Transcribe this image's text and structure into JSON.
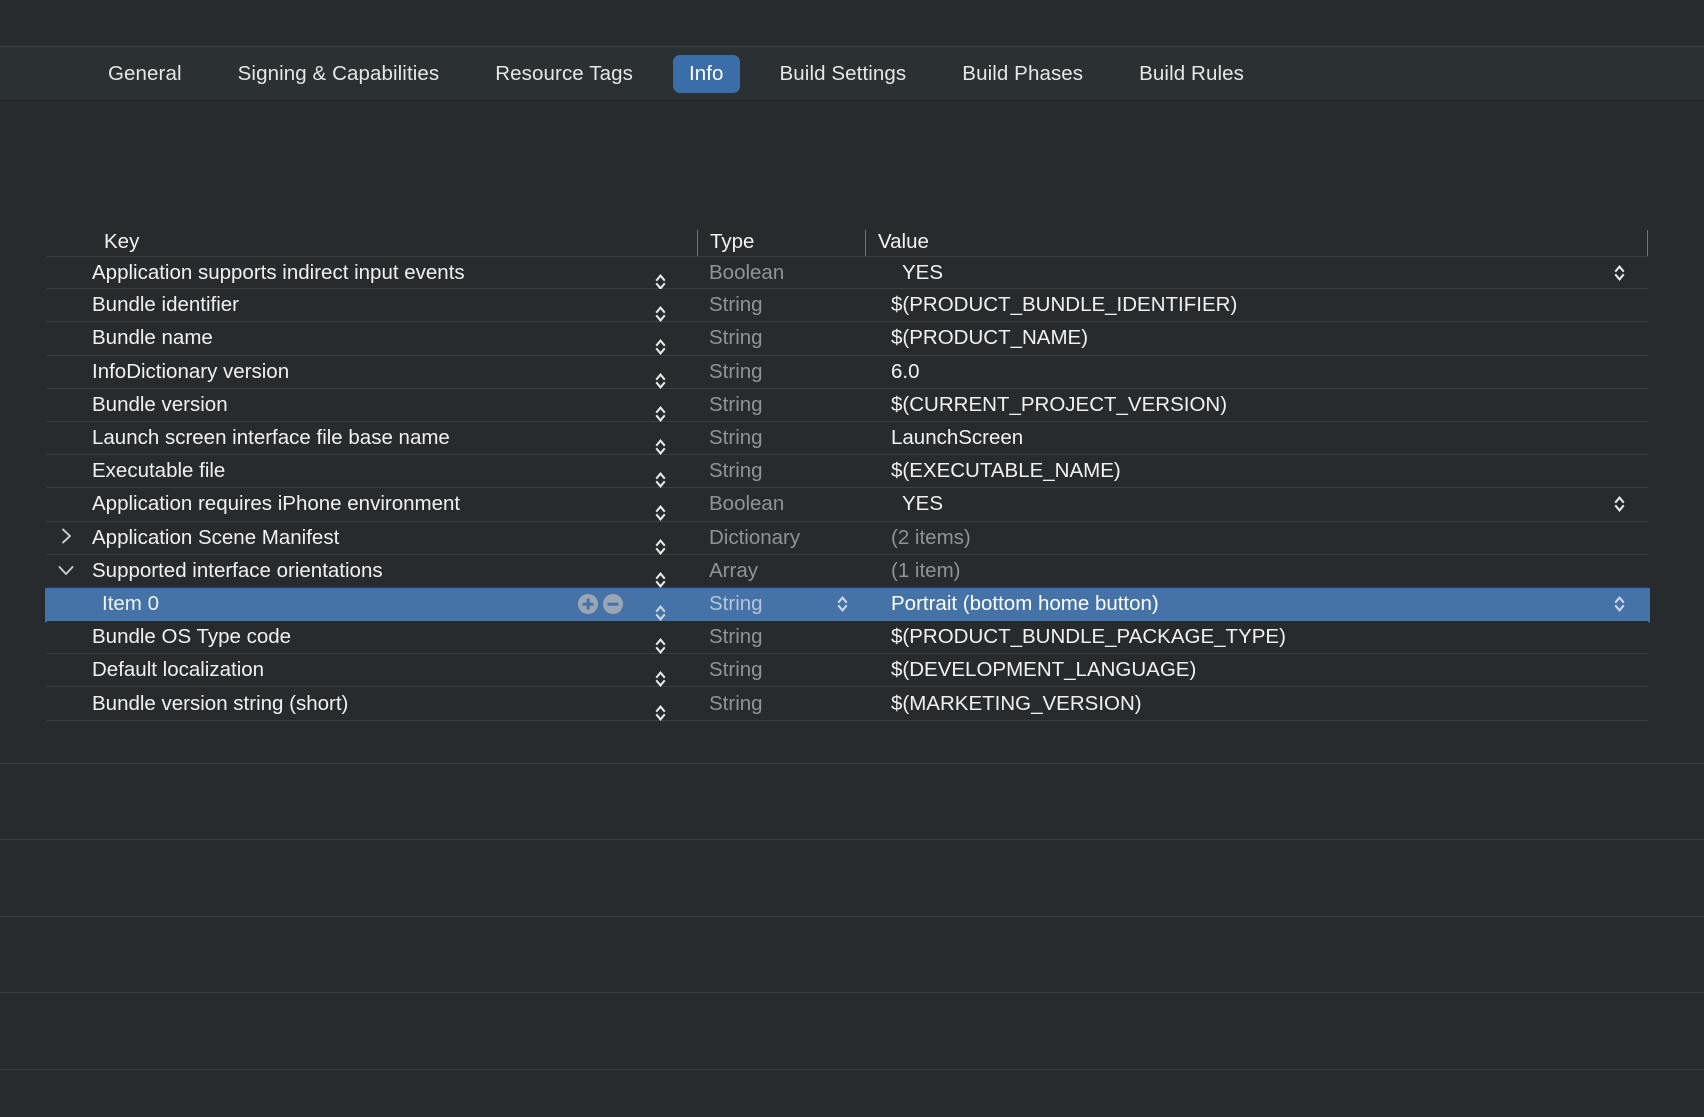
{
  "window": {
    "background": "#272b2d",
    "accent": "#3b6ea8",
    "selection": "#4573a8"
  },
  "tabs": [
    {
      "label": "General",
      "active": false
    },
    {
      "label": "Signing & Capabilities",
      "active": false
    },
    {
      "label": "Resource Tags",
      "active": false
    },
    {
      "label": "Info",
      "active": true
    },
    {
      "label": "Build Settings",
      "active": false
    },
    {
      "label": "Build Phases",
      "active": false
    },
    {
      "label": "Build Rules",
      "active": false
    }
  ],
  "table": {
    "columns": {
      "key": "Key",
      "type": "Type",
      "value": "Value"
    },
    "rows": [
      {
        "key": "Application supports indirect input events",
        "type": "Boolean",
        "value": "YES",
        "twisty": "",
        "indent": false,
        "selected": false,
        "value_stepper": true,
        "type_stepper": false,
        "dim_value": false,
        "bool": true
      },
      {
        "key": "Bundle identifier",
        "type": "String",
        "value": "$(PRODUCT_BUNDLE_IDENTIFIER)",
        "twisty": "",
        "indent": false,
        "selected": false,
        "value_stepper": false,
        "type_stepper": false,
        "dim_value": false,
        "bool": false
      },
      {
        "key": "Bundle name",
        "type": "String",
        "value": "$(PRODUCT_NAME)",
        "twisty": "",
        "indent": false,
        "selected": false,
        "value_stepper": false,
        "type_stepper": false,
        "dim_value": false,
        "bool": false
      },
      {
        "key": "InfoDictionary version",
        "type": "String",
        "value": "6.0",
        "twisty": "",
        "indent": false,
        "selected": false,
        "value_stepper": false,
        "type_stepper": false,
        "dim_value": false,
        "bool": false
      },
      {
        "key": "Bundle version",
        "type": "String",
        "value": "$(CURRENT_PROJECT_VERSION)",
        "twisty": "",
        "indent": false,
        "selected": false,
        "value_stepper": false,
        "type_stepper": false,
        "dim_value": false,
        "bool": false
      },
      {
        "key": "Launch screen interface file base name",
        "type": "String",
        "value": "LaunchScreen",
        "twisty": "",
        "indent": false,
        "selected": false,
        "value_stepper": false,
        "type_stepper": false,
        "dim_value": false,
        "bool": false
      },
      {
        "key": "Executable file",
        "type": "String",
        "value": "$(EXECUTABLE_NAME)",
        "twisty": "",
        "indent": false,
        "selected": false,
        "value_stepper": false,
        "type_stepper": false,
        "dim_value": false,
        "bool": false
      },
      {
        "key": "Application requires iPhone environment",
        "type": "Boolean",
        "value": "YES",
        "twisty": "",
        "indent": false,
        "selected": false,
        "value_stepper": true,
        "type_stepper": false,
        "dim_value": false,
        "bool": true
      },
      {
        "key": "Application Scene Manifest",
        "type": "Dictionary",
        "value": "(2 items)",
        "twisty": "collapsed",
        "indent": false,
        "selected": false,
        "value_stepper": false,
        "type_stepper": false,
        "dim_value": true,
        "bool": false
      },
      {
        "key": "Supported interface orientations",
        "type": "Array",
        "value": "(1 item)",
        "twisty": "expanded",
        "indent": false,
        "selected": false,
        "value_stepper": false,
        "type_stepper": false,
        "dim_value": true,
        "bool": false
      },
      {
        "key": "Item 0",
        "type": "String",
        "value": "Portrait (bottom home button)",
        "twisty": "",
        "indent": true,
        "selected": true,
        "value_stepper": true,
        "type_stepper": true,
        "dim_value": false,
        "bool": false
      },
      {
        "key": "Bundle OS Type code",
        "type": "String",
        "value": "$(PRODUCT_BUNDLE_PACKAGE_TYPE)",
        "twisty": "",
        "indent": false,
        "selected": false,
        "value_stepper": false,
        "type_stepper": false,
        "dim_value": false,
        "bool": false
      },
      {
        "key": "Default localization",
        "type": "String",
        "value": "$(DEVELOPMENT_LANGUAGE)",
        "twisty": "",
        "indent": false,
        "selected": false,
        "value_stepper": false,
        "type_stepper": false,
        "dim_value": false,
        "bool": false
      },
      {
        "key": "Bundle version string (short)",
        "type": "String",
        "value": "$(MARKETING_VERSION)",
        "twisty": "",
        "indent": false,
        "selected": false,
        "value_stepper": false,
        "type_stepper": false,
        "dim_value": false,
        "bool": false
      }
    ],
    "empty_row_count": 5
  },
  "icons": {
    "twisty_collapsed": "chevron-right-icon",
    "twisty_expanded": "chevron-down-icon",
    "stepper": "stepper-up-down-icon",
    "add": "add-item-icon",
    "remove": "remove-item-icon"
  }
}
